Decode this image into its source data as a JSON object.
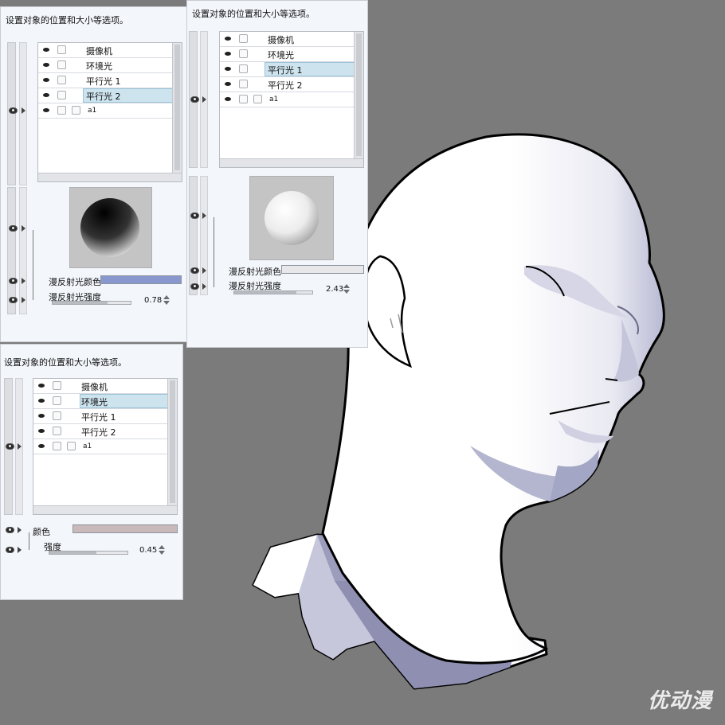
{
  "panels": {
    "panel_a": {
      "title": "设置对象的位置和大小等选项。",
      "layers": [
        {
          "label": "摄像机",
          "checks": 1,
          "selected": false
        },
        {
          "label": "环境光",
          "checks": 1,
          "selected": false
        },
        {
          "label": "平行光 1",
          "checks": 1,
          "selected": false
        },
        {
          "label": "平行光 2",
          "checks": 1,
          "selected": true
        },
        {
          "label": "a1",
          "checks": 2,
          "selected": false
        }
      ],
      "color_label": "漫反射光颜色",
      "intensity_label": "漫反射光强度",
      "intensity_value": "0.78",
      "swatch_color": "#8898cf",
      "sphere": "dark"
    },
    "panel_b": {
      "title": "设置对象的位置和大小等选项。",
      "layers": [
        {
          "label": "摄像机",
          "checks": 1,
          "selected": false
        },
        {
          "label": "环境光",
          "checks": 1,
          "selected": false
        },
        {
          "label": "平行光 1",
          "checks": 1,
          "selected": true
        },
        {
          "label": "平行光 2",
          "checks": 1,
          "selected": false
        },
        {
          "label": "a1",
          "checks": 2,
          "selected": false
        }
      ],
      "color_label": "漫反射光颜色",
      "intensity_label": "漫反射光强度",
      "intensity_value": "2.43",
      "swatch_color": "#e8e8ea",
      "sphere": "light"
    },
    "panel_c": {
      "title": "设置对象的位置和大小等选项。",
      "layers": [
        {
          "label": "摄像机",
          "checks": 1,
          "selected": false
        },
        {
          "label": "环境光",
          "checks": 1,
          "selected": true
        },
        {
          "label": "平行光 1",
          "checks": 1,
          "selected": false
        },
        {
          "label": "平行光 2",
          "checks": 1,
          "selected": false
        },
        {
          "label": "a1",
          "checks": 2,
          "selected": false
        }
      ],
      "color_label": "颜色",
      "intensity_label": "强度",
      "intensity_value": "0.45",
      "swatch_color": "#c9b9bb"
    }
  },
  "watermark": "优动漫",
  "colors": {
    "background": "#7b7b7b",
    "selection": "#cde4ef",
    "head_shadow": "#9a9cc0"
  }
}
